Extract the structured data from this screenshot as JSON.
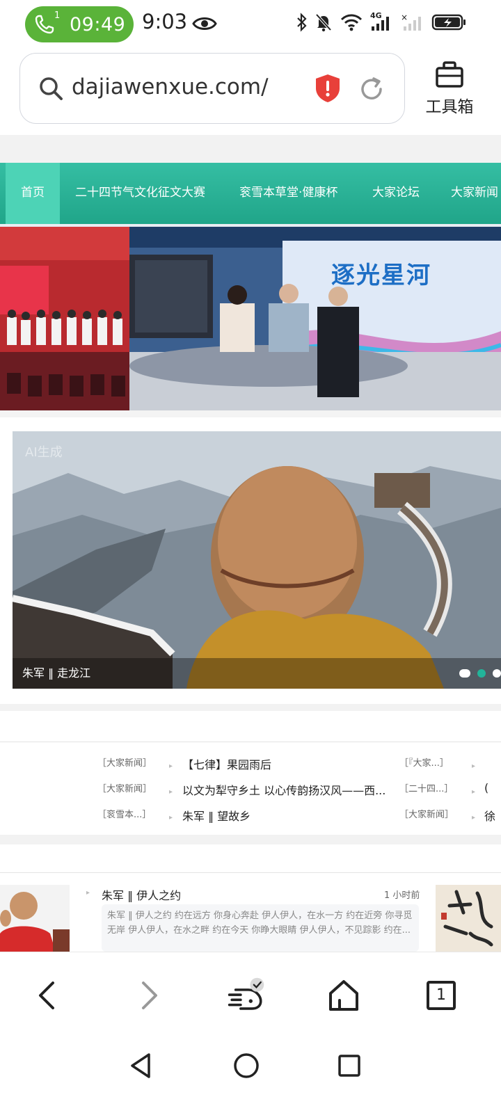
{
  "status_bar": {
    "call_sim": "1",
    "call_timer": "09:49",
    "clock": "9:03",
    "network": "4G",
    "icons": [
      "phone-icon",
      "eye-icon",
      "bluetooth-icon",
      "mute-bell-icon",
      "wifi-icon",
      "signal-icon",
      "no-signal-icon",
      "battery-charging-icon"
    ]
  },
  "address_bar": {
    "url": "dajiawenxue.com/",
    "icons": [
      "search-icon",
      "security-warning-icon",
      "reload-icon"
    ]
  },
  "toolbox": {
    "label": "工具箱",
    "icon": "toolbox-icon"
  },
  "nav": {
    "items": [
      {
        "label": "首页",
        "active": true
      },
      {
        "label": "二十四节气文化征文大赛",
        "active": false
      },
      {
        "label": "衮雪本草堂·健康杯",
        "active": false
      },
      {
        "label": "大家论坛",
        "active": false
      },
      {
        "label": "大家新闻",
        "active": false
      }
    ]
  },
  "banner": {
    "tv_title": "逐光星河"
  },
  "slider": {
    "caption": "朱军 ‖ 走龙江",
    "watermark": "AI生成",
    "dot_count": 3,
    "active_dot": 1
  },
  "news": {
    "rows": [
      {
        "tag": "［大家新闻］",
        "title": "【七律】果园雨后",
        "tag2": "［『大家...］",
        "more": ""
      },
      {
        "tag": "［大家新闻］",
        "title": "以文为犁守乡土 以心传韵扬汉风——西...",
        "tag2": "［二十四...］",
        "more": "("
      },
      {
        "tag": "［衮雪本...］",
        "title": "朱军 ‖ 望故乡",
        "tag2": "［大家新闻］",
        "more": "徐"
      }
    ]
  },
  "article": {
    "title": "朱军 ‖ 伊人之约",
    "time": "1 小时前",
    "summary": "朱军 ‖ 伊人之约 约在远方 你身心奔赴 伊人伊人，在水一方 约在近旁 你寻觅无岸 伊人伊人，在水之畔 约在今天 你睁大眼睛 伊人伊人，不见踪影 约在..."
  },
  "toolbar": {
    "icons": [
      "back-icon",
      "forward-icon",
      "ai-assistant-icon",
      "home-icon",
      "tabs-icon"
    ],
    "tab_count": "1"
  },
  "system_nav": {
    "icons": [
      "nav-back-icon",
      "nav-home-icon",
      "nav-recents-icon"
    ]
  }
}
